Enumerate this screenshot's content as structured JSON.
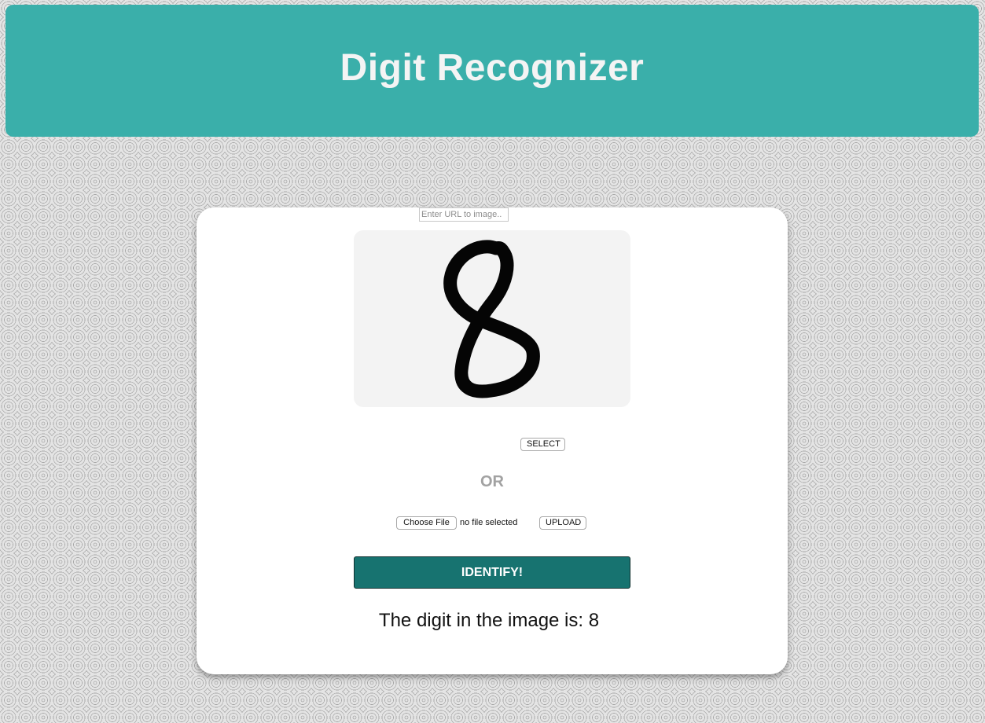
{
  "header": {
    "title": "Digit Recognizer"
  },
  "preview": {
    "image_alt": "handwritten digit 8"
  },
  "url_input": {
    "placeholder": "Enter URL to image.."
  },
  "buttons": {
    "select": "SELECT",
    "choose_file": "Choose File",
    "upload": "UPLOAD",
    "identify": "IDENTIFY!"
  },
  "or_label": "OR",
  "file_status": "no file selected",
  "result": "The digit in the image is: 8",
  "colors": {
    "header_bg": "#3aafaa",
    "identify_bg": "#177370",
    "card_bg": "#ffffff",
    "preview_bg": "#f3f3f3"
  }
}
